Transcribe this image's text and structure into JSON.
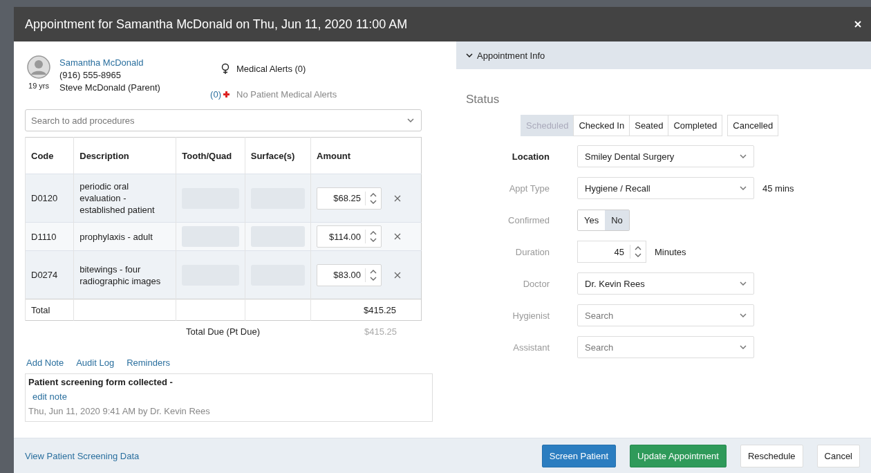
{
  "dialog": {
    "title": "Appointment for Samantha McDonald on Thu, Jun 11, 2020 11:00 AM"
  },
  "patient": {
    "name": "Samantha McDonald",
    "phone": "(916) 555-8965",
    "guardian": "Steve McDonald (Parent)",
    "age": "19 yrs",
    "medical_alerts": "Medical Alerts (0)",
    "alert_count": "(0)",
    "alert_text": "No Patient Medical Alerts"
  },
  "procedure_search": {
    "placeholder": "Search to add procedures"
  },
  "procedures": {
    "columns": [
      "Code",
      "Description",
      "Tooth/Quad",
      "Surface(s)",
      "Amount"
    ],
    "rows": [
      {
        "code": "D0120",
        "description": "periodic oral evaluation - established patient",
        "amount": "$68.25"
      },
      {
        "code": "D1110",
        "description": "prophylaxis - adult",
        "amount": "$114.00"
      },
      {
        "code": "D0274",
        "description": "bitewings - four radiographic images",
        "amount": "$83.00"
      }
    ],
    "total_label": "Total",
    "total": "$415.25"
  },
  "total_due": {
    "label": "Total Due (Pt Due)",
    "value": "$415.25"
  },
  "note_links": [
    "Add Note",
    "Audit Log",
    "Reminders"
  ],
  "note": {
    "text": "Patient screening form collected -",
    "edit_link": "edit note",
    "meta": "Thu, Jun 11, 2020 9:41 AM by Dr. Kevin Rees"
  },
  "view_link": "View Patient Screening Data",
  "appointment_info": {
    "heading": "Appointment Info",
    "expanded": true
  },
  "status": {
    "label": "Status",
    "options": [
      {
        "label": "Scheduled",
        "selected": true
      },
      {
        "label": "Checked In",
        "selected": false
      },
      {
        "label": "Seated",
        "selected": false
      },
      {
        "label": "Completed",
        "selected": false
      },
      {
        "label": "Cancelled",
        "selected": false
      }
    ]
  },
  "fields": [
    {
      "kind": "select",
      "label": "Location",
      "bold": true,
      "value": "Smiley Dental Surgery"
    },
    {
      "kind": "select",
      "label": "Appt Type",
      "bold": false,
      "value": "Hygiene / Recall",
      "suffix": "45 mins"
    },
    {
      "kind": "toggle",
      "label": "Confirmed",
      "bold": false,
      "options": [
        {
          "label": "Yes",
          "selected": false
        },
        {
          "label": "No",
          "selected": true
        }
      ]
    },
    {
      "kind": "number",
      "label": "Duration",
      "bold": false,
      "value": "45",
      "suffix": "Minutes"
    },
    {
      "kind": "select",
      "label": "Doctor",
      "bold": false,
      "value": "Dr. Kevin Rees"
    },
    {
      "kind": "select",
      "label": "Hygienist",
      "bold": false,
      "placeholder": "Search"
    },
    {
      "kind": "select",
      "label": "Assistant",
      "bold": false,
      "placeholder": "Search"
    }
  ],
  "buttons": [
    {
      "label": "Screen Patient",
      "kind": "primary"
    },
    {
      "label": "Update Appointment",
      "kind": "success"
    },
    {
      "label": "Reschedule",
      "kind": "default"
    },
    {
      "label": "Cancel",
      "kind": "default"
    }
  ]
}
